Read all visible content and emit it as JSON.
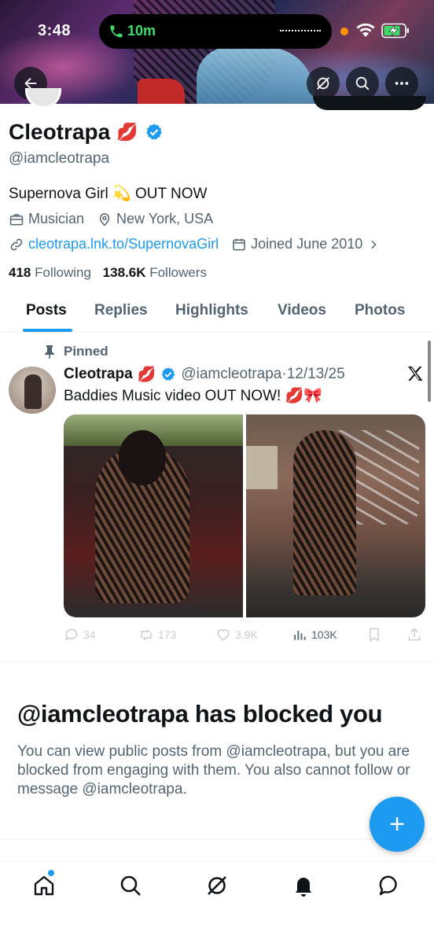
{
  "status_bar": {
    "time": "3:48",
    "call_time": "10m"
  },
  "profile": {
    "name": "Cleotrapa",
    "name_emoji": "💋",
    "handle": "@iamcleotrapa",
    "bio": "Supernova Girl 💫 OUT NOW",
    "category": "Musician",
    "location": "New York, USA",
    "link": "cleotrapa.lnk.to/SupernovaGirl",
    "joined": "Joined June 2010",
    "following_count": "418",
    "following_label": "Following",
    "followers_count": "138.6K",
    "followers_label": "Followers"
  },
  "tabs": [
    {
      "label": "Posts",
      "active": true
    },
    {
      "label": "Replies",
      "active": false
    },
    {
      "label": "Highlights",
      "active": false
    },
    {
      "label": "Videos",
      "active": false
    },
    {
      "label": "Photos",
      "active": false
    }
  ],
  "pinned_post": {
    "pinned_label": "Pinned",
    "author_name": "Cleotrapa",
    "author_emoji": "💋",
    "author_handle": "@iamcleotrapa",
    "separator": "·",
    "date": "12/13/25",
    "text": "Baddies Music video OUT NOW! 💋🎀",
    "replies": "34",
    "reposts": "173",
    "likes": "3.9K",
    "views": "103K"
  },
  "blocked": {
    "title": "@iamcleotrapa has blocked you",
    "text": "You can view public posts from @iamcleotrapa, but you are blocked from engaging with them. You also cannot follow or message @iamcleotrapa."
  },
  "fab_label": "+",
  "colors": {
    "accent": "#1d9bf0",
    "text_primary": "#0f1419",
    "text_secondary": "#536471",
    "call_green": "#3ddc6a"
  }
}
